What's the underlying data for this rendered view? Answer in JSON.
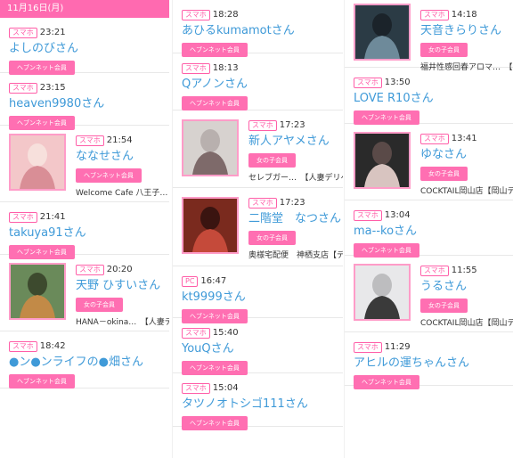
{
  "date_header": "11月16日(月)",
  "badge_sp": "スマホ",
  "badge_pc": "PC",
  "tag_heaven": "ヘブンネット会員",
  "tag_girl": "女の子会員",
  "col1": [
    {
      "time": "23:21",
      "name": "よしのびさん",
      "tag": "heaven"
    },
    {
      "time": "23:15",
      "name": "heaven9980さん",
      "tag": "heaven"
    },
    {
      "time": "21:54",
      "name": "ななせさん",
      "tag": "heaven",
      "shop": "Welcome Cafe 八王子…　【",
      "thumb": true
    },
    {
      "time": "21:41",
      "name": "takuya91さん",
      "tag": "heaven"
    },
    {
      "time": "20:20",
      "name": "天野 ひすいさん",
      "tag": "girl",
      "shop": "HANA－okina…　【人妻デリ",
      "thumb": true
    },
    {
      "time": "18:42",
      "name": "●ン●ンライフの●畑さん",
      "tag": "heaven"
    }
  ],
  "col2": [
    {
      "time": "18:28",
      "name": "あひるkumamotさん",
      "tag": "heaven"
    },
    {
      "time": "18:13",
      "name": "Qアノンさん",
      "tag": "heaven"
    },
    {
      "time": "17:23",
      "name": "新人アヤメさん",
      "tag": "girl",
      "shop": "セレブガー…　【人妻デリヘ",
      "thumb": true
    },
    {
      "time": "17:23",
      "name": "二階堂　なつさん",
      "tag": "girl",
      "shop": "奥様宅配便　神栖支店【デリ",
      "thumb": true
    },
    {
      "time": "16:47",
      "name": "kt9999さん",
      "tag": "heaven",
      "pc": true
    },
    {
      "time": "15:40",
      "name": "YouQさん",
      "tag": "heaven"
    },
    {
      "time": "15:04",
      "name": "タツノオトシゴ111さん",
      "tag": "heaven"
    }
  ],
  "col3": [
    {
      "time": "14:18",
      "name": "天音きらりさん",
      "tag": "girl",
      "shop": "福井性感回春アロマ…　【出",
      "thumb": true
    },
    {
      "time": "13:50",
      "name": "LOVE R10さん",
      "tag": "heaven"
    },
    {
      "time": "13:41",
      "name": "ゆなさん",
      "tag": "girl",
      "shop": "COCKTAIL岡山店【岡山デリ",
      "thumb": true
    },
    {
      "time": "13:04",
      "name": "ma--koさん",
      "tag": "heaven"
    },
    {
      "time": "11:55",
      "name": "うるさん",
      "tag": "girl",
      "shop": "COCKTAIL岡山店【岡山デリ",
      "thumb": true
    },
    {
      "time": "11:29",
      "name": "アヒルの運ちゃんさん",
      "tag": "heaven"
    }
  ],
  "colors": {
    "pink": "#ff6ab0",
    "blue": "#3f9ad8"
  }
}
